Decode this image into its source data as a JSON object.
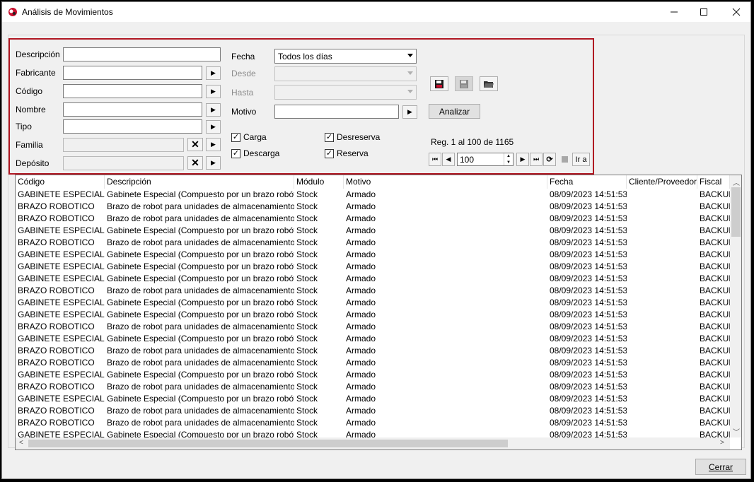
{
  "window": {
    "title": "Análisis de Movimientos"
  },
  "filters": {
    "descripcion_label": "Descripción",
    "fabricante_label": "Fabricante",
    "codigo_label": "Código",
    "nombre_label": "Nombre",
    "tipo_label": "Tipo",
    "familia_label": "Familia",
    "deposito_label": "Depósito",
    "fecha_label": "Fecha",
    "fecha_value": "Todos los días",
    "desde_label": "Desde",
    "hasta_label": "Hasta",
    "motivo_label": "Motivo"
  },
  "checks": {
    "carga": {
      "label": "Carga",
      "checked": true
    },
    "descarga": {
      "label": "Descarga",
      "checked": true
    },
    "desreserva": {
      "label": "Desreserva",
      "checked": true
    },
    "reserva": {
      "label": "Reserva",
      "checked": true
    }
  },
  "actions": {
    "analizar": "Analizar",
    "cerrar": "Cerrar"
  },
  "paging": {
    "status": "Reg. 1 al 100 de 1165",
    "page_size": "100",
    "ira": "Ir a"
  },
  "grid": {
    "columns": [
      "Código",
      "Descripción",
      "Módulo",
      "Motivo",
      "Fecha",
      "Cliente/Proveedor",
      "Fiscal"
    ],
    "rows": [
      [
        "GABINETE ESPECIAL",
        "Gabinete Especial (Compuesto por un brazo robótico y",
        "Stock",
        "Armado",
        "08/09/2023 14:51:53",
        "",
        "BACKUF"
      ],
      [
        "BRAZO ROBOTICO",
        "Brazo de robot para unidades de almacenamiento.",
        "Stock",
        "Armado",
        "08/09/2023 14:51:53",
        "",
        "BACKUF"
      ],
      [
        "BRAZO ROBOTICO",
        "Brazo de robot para unidades de almacenamiento.",
        "Stock",
        "Armado",
        "08/09/2023 14:51:53",
        "",
        "BACKUF"
      ],
      [
        "GABINETE ESPECIAL",
        "Gabinete Especial (Compuesto por un brazo robótico y",
        "Stock",
        "Armado",
        "08/09/2023 14:51:53",
        "",
        "BACKUF"
      ],
      [
        "BRAZO ROBOTICO",
        "Brazo de robot para unidades de almacenamiento.",
        "Stock",
        "Armado",
        "08/09/2023 14:51:53",
        "",
        "BACKUF"
      ],
      [
        "GABINETE ESPECIAL",
        "Gabinete Especial (Compuesto por un brazo robótico y",
        "Stock",
        "Armado",
        "08/09/2023 14:51:53",
        "",
        "BACKUF"
      ],
      [
        "GABINETE ESPECIAL",
        "Gabinete Especial (Compuesto por un brazo robótico y",
        "Stock",
        "Armado",
        "08/09/2023 14:51:53",
        "",
        "BACKUF"
      ],
      [
        "GABINETE ESPECIAL",
        "Gabinete Especial (Compuesto por un brazo robótico y",
        "Stock",
        "Armado",
        "08/09/2023 14:51:53",
        "",
        "BACKUF"
      ],
      [
        "BRAZO ROBOTICO",
        "Brazo de robot para unidades de almacenamiento.",
        "Stock",
        "Armado",
        "08/09/2023 14:51:53",
        "",
        "BACKUF"
      ],
      [
        "GABINETE ESPECIAL",
        "Gabinete Especial (Compuesto por un brazo robótico y",
        "Stock",
        "Armado",
        "08/09/2023 14:51:53",
        "",
        "BACKUF"
      ],
      [
        "GABINETE ESPECIAL",
        "Gabinete Especial (Compuesto por un brazo robótico y",
        "Stock",
        "Armado",
        "08/09/2023 14:51:53",
        "",
        "BACKUF"
      ],
      [
        "BRAZO ROBOTICO",
        "Brazo de robot para unidades de almacenamiento.",
        "Stock",
        "Armado",
        "08/09/2023 14:51:53",
        "",
        "BACKUF"
      ],
      [
        "GABINETE ESPECIAL",
        "Gabinete Especial (Compuesto por un brazo robótico y",
        "Stock",
        "Armado",
        "08/09/2023 14:51:53",
        "",
        "BACKUF"
      ],
      [
        "BRAZO ROBOTICO",
        "Brazo de robot para unidades de almacenamiento.",
        "Stock",
        "Armado",
        "08/09/2023 14:51:53",
        "",
        "BACKUF"
      ],
      [
        "BRAZO ROBOTICO",
        "Brazo de robot para unidades de almacenamiento.",
        "Stock",
        "Armado",
        "08/09/2023 14:51:53",
        "",
        "BACKUF"
      ],
      [
        "GABINETE ESPECIAL",
        "Gabinete Especial (Compuesto por un brazo robótico y",
        "Stock",
        "Armado",
        "08/09/2023 14:51:53",
        "",
        "BACKUF"
      ],
      [
        "BRAZO ROBOTICO",
        "Brazo de robot para unidades de almacenamiento.",
        "Stock",
        "Armado",
        "08/09/2023 14:51:53",
        "",
        "BACKUF"
      ],
      [
        "GABINETE ESPECIAL",
        "Gabinete Especial (Compuesto por un brazo robótico y",
        "Stock",
        "Armado",
        "08/09/2023 14:51:53",
        "",
        "BACKUF"
      ],
      [
        "BRAZO ROBOTICO",
        "Brazo de robot para unidades de almacenamiento.",
        "Stock",
        "Armado",
        "08/09/2023 14:51:53",
        "",
        "BACKUF"
      ],
      [
        "BRAZO ROBOTICO",
        "Brazo de robot para unidades de almacenamiento.",
        "Stock",
        "Armado",
        "08/09/2023 14:51:53",
        "",
        "BACKUF"
      ],
      [
        "GABINETE ESPECIAL",
        "Gabinete Especial (Compuesto por un brazo robótico y",
        "Stock",
        "Armado",
        "08/09/2023 14:51:53",
        "",
        "BACKUF"
      ]
    ]
  },
  "colors": {
    "highlight_border": "#b01722",
    "window_bg": "#f0f0f0"
  },
  "icons": [
    "app-icon",
    "minimize-icon",
    "maximize-icon",
    "close-icon",
    "arrow-right-icon",
    "clear-x-icon",
    "save-icon",
    "save-disabled-icon",
    "folder-open-icon",
    "first-page-icon",
    "prev-page-icon",
    "next-page-icon",
    "last-page-icon",
    "refresh-icon",
    "stop-icon"
  ]
}
